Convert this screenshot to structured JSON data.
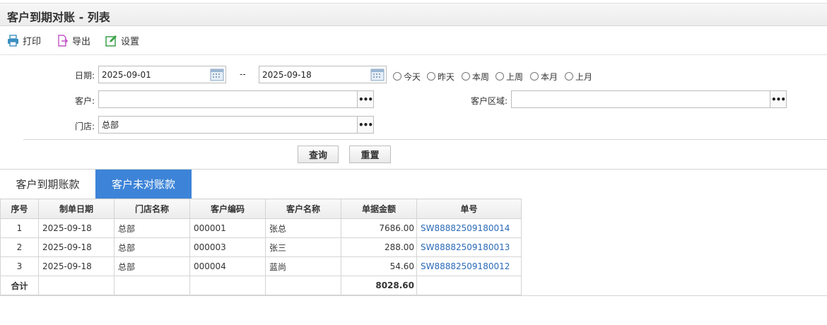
{
  "page_title": "客户到期对账 - 列表",
  "toolbar": {
    "print_label": "打印",
    "export_label": "导出",
    "settings_label": "设置"
  },
  "filters": {
    "date_label": "日期:",
    "date_from": "2025-09-01",
    "date_sep": "--",
    "date_to": "2025-09-18",
    "quick_ranges": [
      "今天",
      "昨天",
      "本周",
      "上周",
      "本月",
      "上月"
    ],
    "customer_label": "客户:",
    "customer_value": "",
    "customer_area_label": "客户区域:",
    "customer_area_value": "",
    "store_label": "门店:",
    "store_value": "总部",
    "more_glyph": "•••"
  },
  "actions": {
    "query_label": "查询",
    "reset_label": "重置"
  },
  "tabs": [
    {
      "label": "客户到期账款",
      "active": false
    },
    {
      "label": "客户未对账款",
      "active": true
    }
  ],
  "table": {
    "columns": [
      "序号",
      "制单日期",
      "门店名称",
      "客户编码",
      "客户名称",
      "单据金额",
      "单号"
    ],
    "rows": [
      [
        "1",
        "2025-09-18",
        "总部",
        "000001",
        "张总",
        "7686.00",
        "SW88882509180014"
      ],
      [
        "2",
        "2025-09-18",
        "总部",
        "000003",
        "张三",
        "288.00",
        "SW88882509180013"
      ],
      [
        "3",
        "2025-09-18",
        "总部",
        "000004",
        "蓝尚",
        "54.60",
        "SW88882509180012"
      ]
    ],
    "total_label": "合计",
    "total_amount": "8028.60"
  },
  "colors": {
    "active_tab": "#3d84d8",
    "link": "#2a6ab7"
  }
}
